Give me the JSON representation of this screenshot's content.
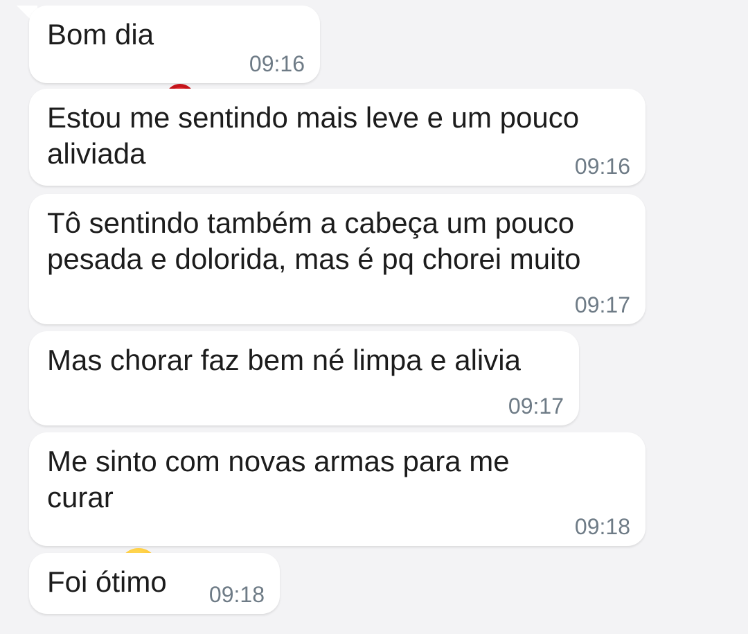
{
  "messages": [
    {
      "text": "Bom dia",
      "emoji": "rose-icon",
      "time": "09:16"
    },
    {
      "text": "Estou me sentindo mais leve e um pouco\naliviada",
      "time": "09:16"
    },
    {
      "text": "Tô sentindo também a cabeça um pouco\npesada e dolorida, mas é pq chorei muito",
      "time": "09:17"
    },
    {
      "text": "Mas chorar faz bem né limpa e alivia",
      "time": "09:17"
    },
    {
      "text": "Me sinto com novas armas para me\ncurar",
      "emoji": "kissing-face-icon",
      "time": "09:18"
    },
    {
      "text": "Foi ótimo",
      "time": "09:18"
    }
  ],
  "colors": {
    "background": "#f3f3f5",
    "bubble": "#ffffff",
    "text": "#1c1c1c",
    "time": "#6e7b86"
  }
}
